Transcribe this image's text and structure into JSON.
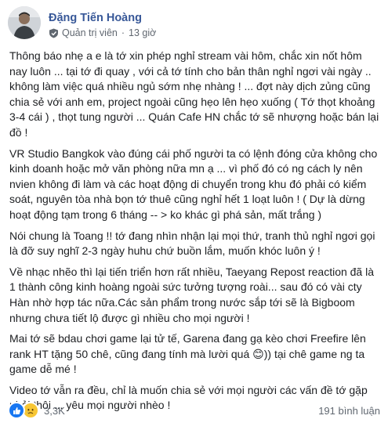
{
  "post": {
    "author": "Đặng Tiến Hoàng",
    "role": "Quản trị viên",
    "separator": "·",
    "time": "13 giờ",
    "paragraphs": [
      "Thông báo nhẹ a e là tớ xin phép nghỉ stream vài hôm, chắc xin nốt hôm nay luôn ... tại tớ đi quay , với cả tớ tính cho bản thân nghỉ ngơi vài ngày .. không làm việc quá nhiều ngủ sớm nhẹ nhàng ! ... đợt này dịch zủng cũng chia sẻ với anh em, project ngoài cũng hẹo lên hẹo xuống ( Tớ thọt khoảng 3-4 cái ) , thọt tung người ... Quán Cafe HN chắc tớ sẽ nhượng hoặc bán lại đồ !",
      "VR Studio Bangkok vào đúng cái phố người ta có lệnh đóng cửa không cho kinh doanh hoặc mở văn phòng nữa mn ạ ... vì phố đó có ng cách ly nên nvien không đi làm và các hoạt động di chuyển trong khu đó phải có kiểm soát, nguyên tòa nhà bọn tớ thuê cũng nghỉ hết 1 loạt luôn ! ( Dự là dừng hoạt động tạm trong 6 tháng -- > ko khác gì phá sản, mất trắng )",
      "Nói chung là Toang !! tớ đang nhìn nhận lại mọi thứ, tranh thủ nghỉ ngơi gọi là đỡ suy nghĩ 2-3 ngày huhu chứ buồn lắm, muốn khóc luôn ý !",
      "Về nhạc nhẽo thì lại tiến triển hơn rất nhiều, Taeyang Repost reaction đã là 1 thành công kinh hoàng ngoài sức tưởng tượng roài... sau đó có vài cty Hàn nhờ hợp tác nữa.Các sản phẩm trong nước sắp tới sẽ là Bigboom nhưng chưa tiết lộ được gì nhiều cho mọi người !",
      "Mai tớ sẽ bdau chơi game lại tử tế, Garena đang gạ kèo chơi Freefire lên rank HT tặng 50 chê, cũng đang tính mà lười quá 😊)) tại chê game ng ta game dễ mé !",
      "Video tớ vẫn ra đều, chỉ là muốn chia sẻ với mọi người các vấn đề tớ gặp phải thôi ... yêu mọi người nhèo !"
    ],
    "reaction_count": "3,3K",
    "comment_count": "191 bình luận"
  },
  "icons": {
    "avatar": "profile-photo",
    "role": "shield-icon",
    "reactions": [
      "like-icon",
      "sad-icon"
    ]
  },
  "colors": {
    "author": "#385898",
    "like": "#1877f2",
    "sad": "#f7c634",
    "muted": "#606770"
  }
}
